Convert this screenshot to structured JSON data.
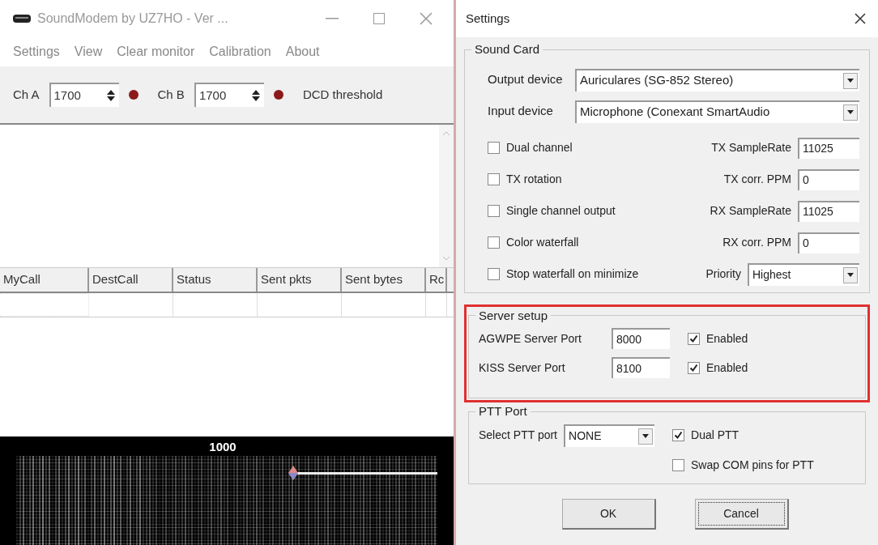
{
  "main_window": {
    "title": "SoundModem by UZ7HO - Ver ...",
    "menu": [
      "Settings",
      "View",
      "Clear monitor",
      "Calibration",
      "About"
    ],
    "channels": [
      {
        "label": "Ch A",
        "value": "1700"
      },
      {
        "label": "Ch B",
        "value": "1700"
      }
    ],
    "dcd_label": "DCD threshold",
    "table": {
      "columns": [
        "MyCall",
        "DestCall",
        "Status",
        "Sent pkts",
        "Sent bytes",
        "Rc"
      ]
    },
    "waterfall": {
      "scale_label": "1000"
    }
  },
  "settings_dialog": {
    "title": "Settings",
    "sound_card": {
      "title": "Sound Card",
      "devices": [
        {
          "label": "Output device",
          "value": "Auriculares (SG-852 Stereo)"
        },
        {
          "label": "Input device",
          "value": "Microphone (Conexant SmartAudio"
        }
      ],
      "options": [
        {
          "label": "Dual channel",
          "checked": false
        },
        {
          "label": "TX rotation",
          "checked": false
        },
        {
          "label": "Single channel output",
          "checked": false
        },
        {
          "label": "Color waterfall",
          "checked": false
        },
        {
          "label": "Stop waterfall on minimize",
          "checked": false
        }
      ],
      "settings": [
        {
          "label": "TX SampleRate",
          "value": "11025",
          "kind": "text"
        },
        {
          "label": "TX corr. PPM",
          "value": "0",
          "kind": "text"
        },
        {
          "label": "RX SampleRate",
          "value": "11025",
          "kind": "text"
        },
        {
          "label": "RX corr. PPM",
          "value": "0",
          "kind": "text"
        },
        {
          "label": "Priority",
          "value": "Highest",
          "kind": "select"
        }
      ]
    },
    "server_setup": {
      "title": "Server setup",
      "highlighted": true,
      "ports": [
        {
          "label": "AGWPE Server Port",
          "value": "8000",
          "enabled_label": "Enabled",
          "checked": true
        },
        {
          "label": "KISS Server Port",
          "value": "8100",
          "enabled_label": "Enabled",
          "checked": true
        }
      ]
    },
    "ptt_port": {
      "title": "PTT Port",
      "select_label": "Select PTT port",
      "select_value": "NONE",
      "options": [
        {
          "label": "Dual PTT",
          "checked": true
        },
        {
          "label": "Swap COM pins for PTT",
          "checked": false
        }
      ]
    },
    "buttons": [
      {
        "label": "OK",
        "focused": false
      },
      {
        "label": "Cancel",
        "focused": true
      }
    ]
  }
}
